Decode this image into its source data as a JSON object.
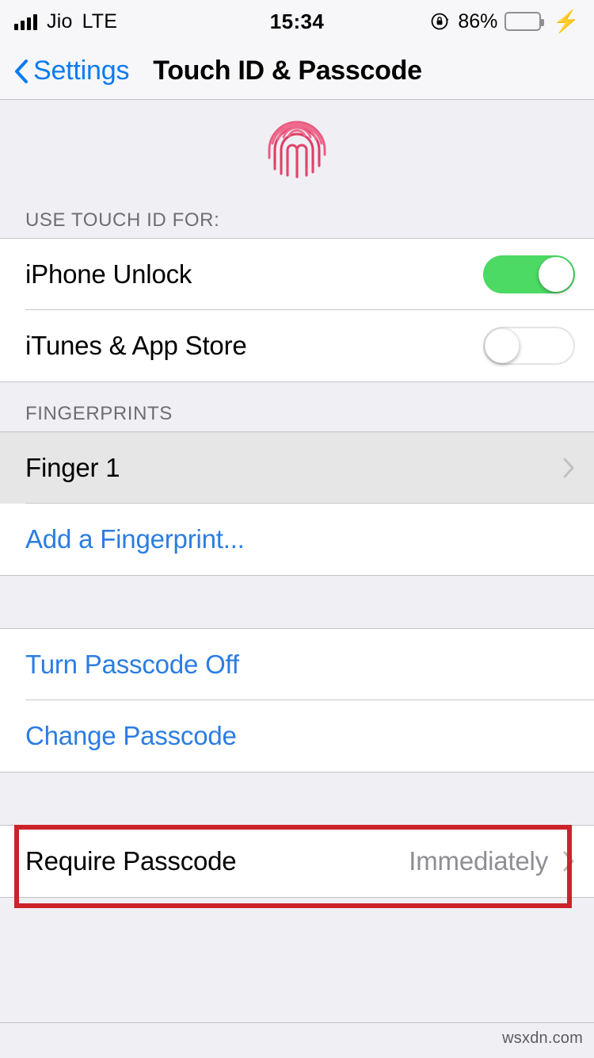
{
  "status_bar": {
    "carrier": "Jio",
    "network": "LTE",
    "time": "15:34",
    "battery_percent": "86%",
    "rotation_lock_icon": "rotation-lock-icon",
    "battery_icon": "battery-full-icon",
    "charging_icon": "lightning-bolt-icon",
    "signal_icon": "signal-bars-icon",
    "battery_color": "#4cd964"
  },
  "nav": {
    "back_label": "Settings",
    "back_icon": "chevron-left-icon",
    "title": "Touch ID & Passcode",
    "tint_color": "#0b7bf0"
  },
  "hero": {
    "icon": "fingerprint-icon",
    "color": "#e0456b"
  },
  "sections": [
    {
      "header": "USE TOUCH ID FOR:",
      "rows": [
        {
          "label": "iPhone Unlock",
          "type": "toggle",
          "value": "on"
        },
        {
          "label": "iTunes & App Store",
          "type": "toggle",
          "value": "off"
        }
      ]
    },
    {
      "header": "FINGERPRINTS",
      "rows": [
        {
          "label": "Finger 1",
          "type": "disclosure",
          "selected": true,
          "accessory": "chevron-right-icon"
        },
        {
          "label": "Add a Fingerprint...",
          "type": "link"
        }
      ]
    },
    {
      "header": "",
      "rows": [
        {
          "label": "Turn Passcode Off",
          "type": "link"
        },
        {
          "label": "Change Passcode",
          "type": "link",
          "highlighted": true
        }
      ]
    },
    {
      "header": "",
      "rows": [
        {
          "label": "Require Passcode",
          "type": "value",
          "value": "Immediately",
          "accessory": "chevron-right-icon"
        }
      ]
    }
  ],
  "annotation": {
    "color": "#cc2229",
    "target": "Change Passcode"
  },
  "footer": {
    "watermark": "wsxdn.com"
  }
}
